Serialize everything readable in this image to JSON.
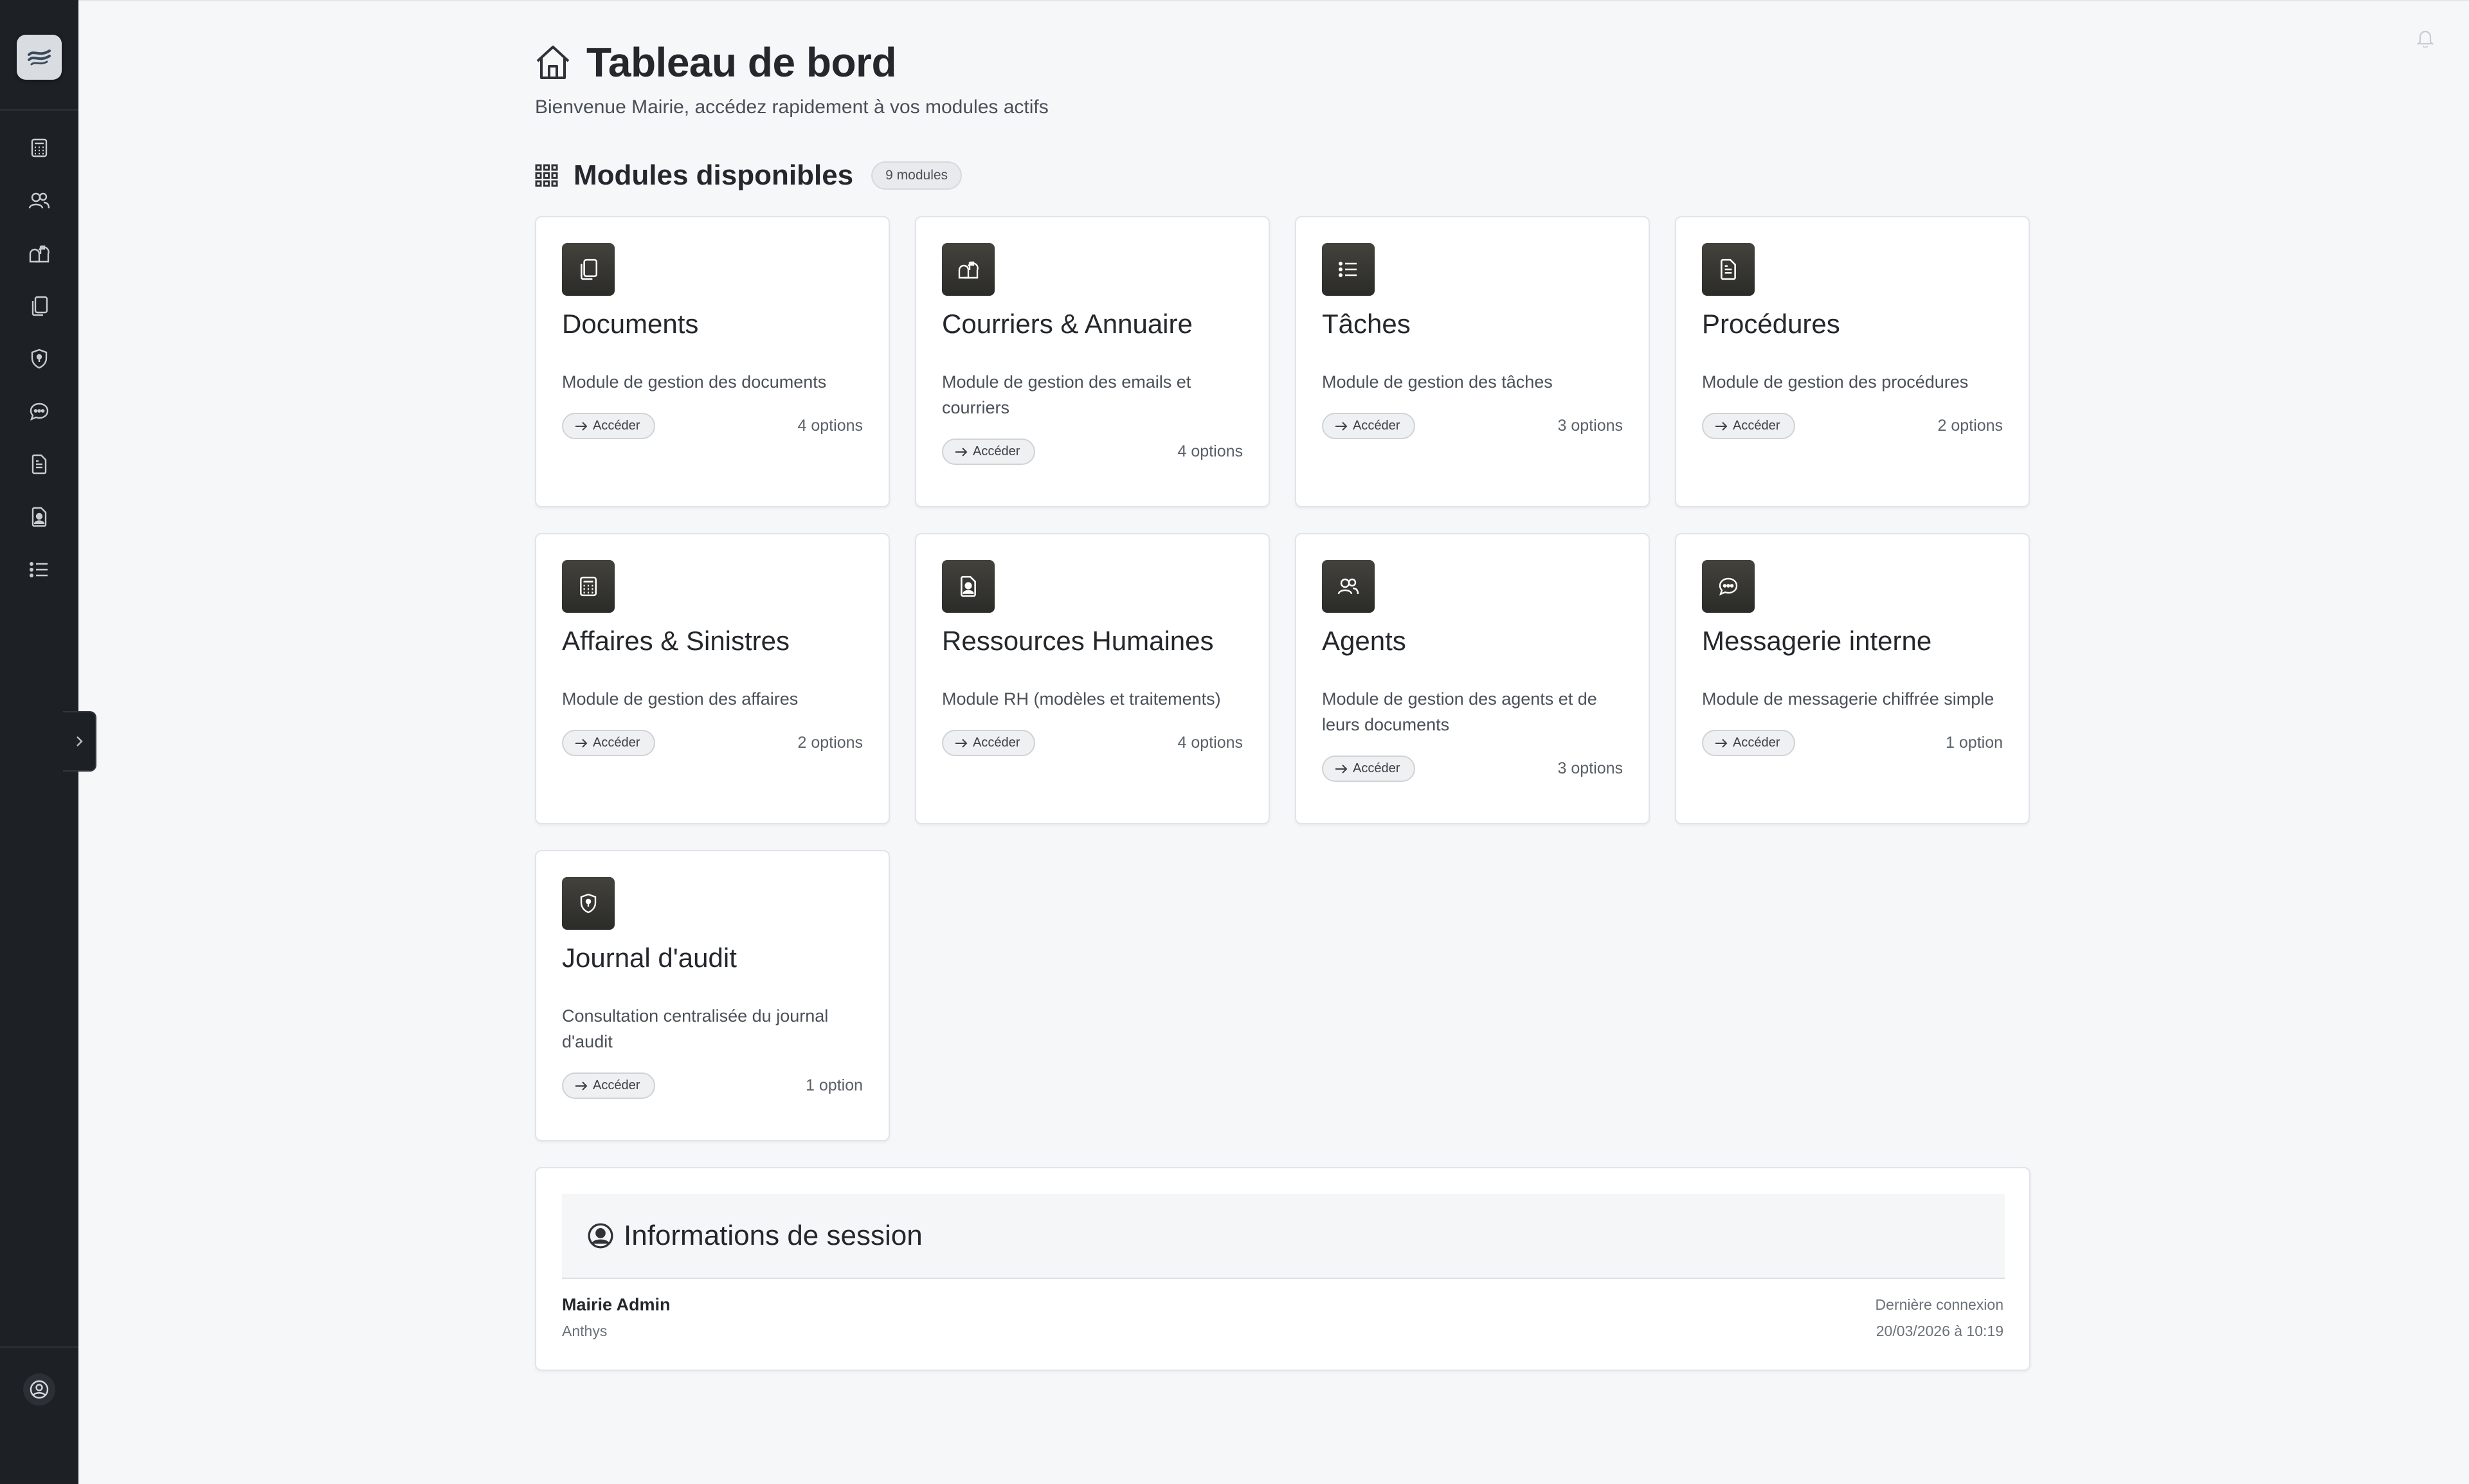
{
  "header": {
    "title": "Tableau de bord",
    "subtitle": "Bienvenue Mairie, accédez rapidement à vos modules actifs"
  },
  "section": {
    "title": "Modules disponibles",
    "badge": "9 modules"
  },
  "sidebar": {
    "items": [
      {
        "icon": "calculator-icon"
      },
      {
        "icon": "users-icon"
      },
      {
        "icon": "mailbox-icon"
      },
      {
        "icon": "copy-icon"
      },
      {
        "icon": "shield-icon"
      },
      {
        "icon": "chat-icon"
      },
      {
        "icon": "file-text-icon"
      },
      {
        "icon": "person-badge-icon"
      },
      {
        "icon": "list-icon"
      }
    ]
  },
  "modules": [
    {
      "title": "Documents",
      "description": "Module de gestion des documents",
      "action": "Accéder",
      "options": "4 options",
      "icon": "copy-icon"
    },
    {
      "title": "Courriers & Annuaire",
      "description": "Module de gestion des emails et courriers",
      "action": "Accéder",
      "options": "4 options",
      "icon": "mailbox-icon"
    },
    {
      "title": "Tâches",
      "description": "Module de gestion des tâches",
      "action": "Accéder",
      "options": "3 options",
      "icon": "list-icon"
    },
    {
      "title": "Procédures",
      "description": "Module de gestion des procédures",
      "action": "Accéder",
      "options": "2 options",
      "icon": "file-text-icon"
    },
    {
      "title": "Affaires & Sinistres",
      "description": "Module de gestion des affaires",
      "action": "Accéder",
      "options": "2 options",
      "icon": "calculator-icon"
    },
    {
      "title": "Ressources Humaines",
      "description": "Module RH (modèles et traitements)",
      "action": "Accéder",
      "options": "4 options",
      "icon": "person-badge-icon"
    },
    {
      "title": "Agents",
      "description": "Module de gestion des agents et de leurs documents",
      "action": "Accéder",
      "options": "3 options",
      "icon": "users-icon"
    },
    {
      "title": "Messagerie interne",
      "description": "Module de messagerie chiffrée simple",
      "action": "Accéder",
      "options": "1 option",
      "icon": "chat-icon"
    },
    {
      "title": "Journal d'audit",
      "description": "Consultation centralisée du journal d'audit",
      "action": "Accéder",
      "options": "1 option",
      "icon": "shield-icon"
    }
  ],
  "session": {
    "title": "Informations de session",
    "name": "Mairie Admin",
    "organization": "Anthys",
    "last_login_label": "Dernière connexion",
    "last_login_value": "20/03/2026 à 10:19"
  },
  "colors": {
    "sidebar": "#1d2024",
    "background": "#f6f7f9",
    "card_icon": "#3a3934"
  }
}
